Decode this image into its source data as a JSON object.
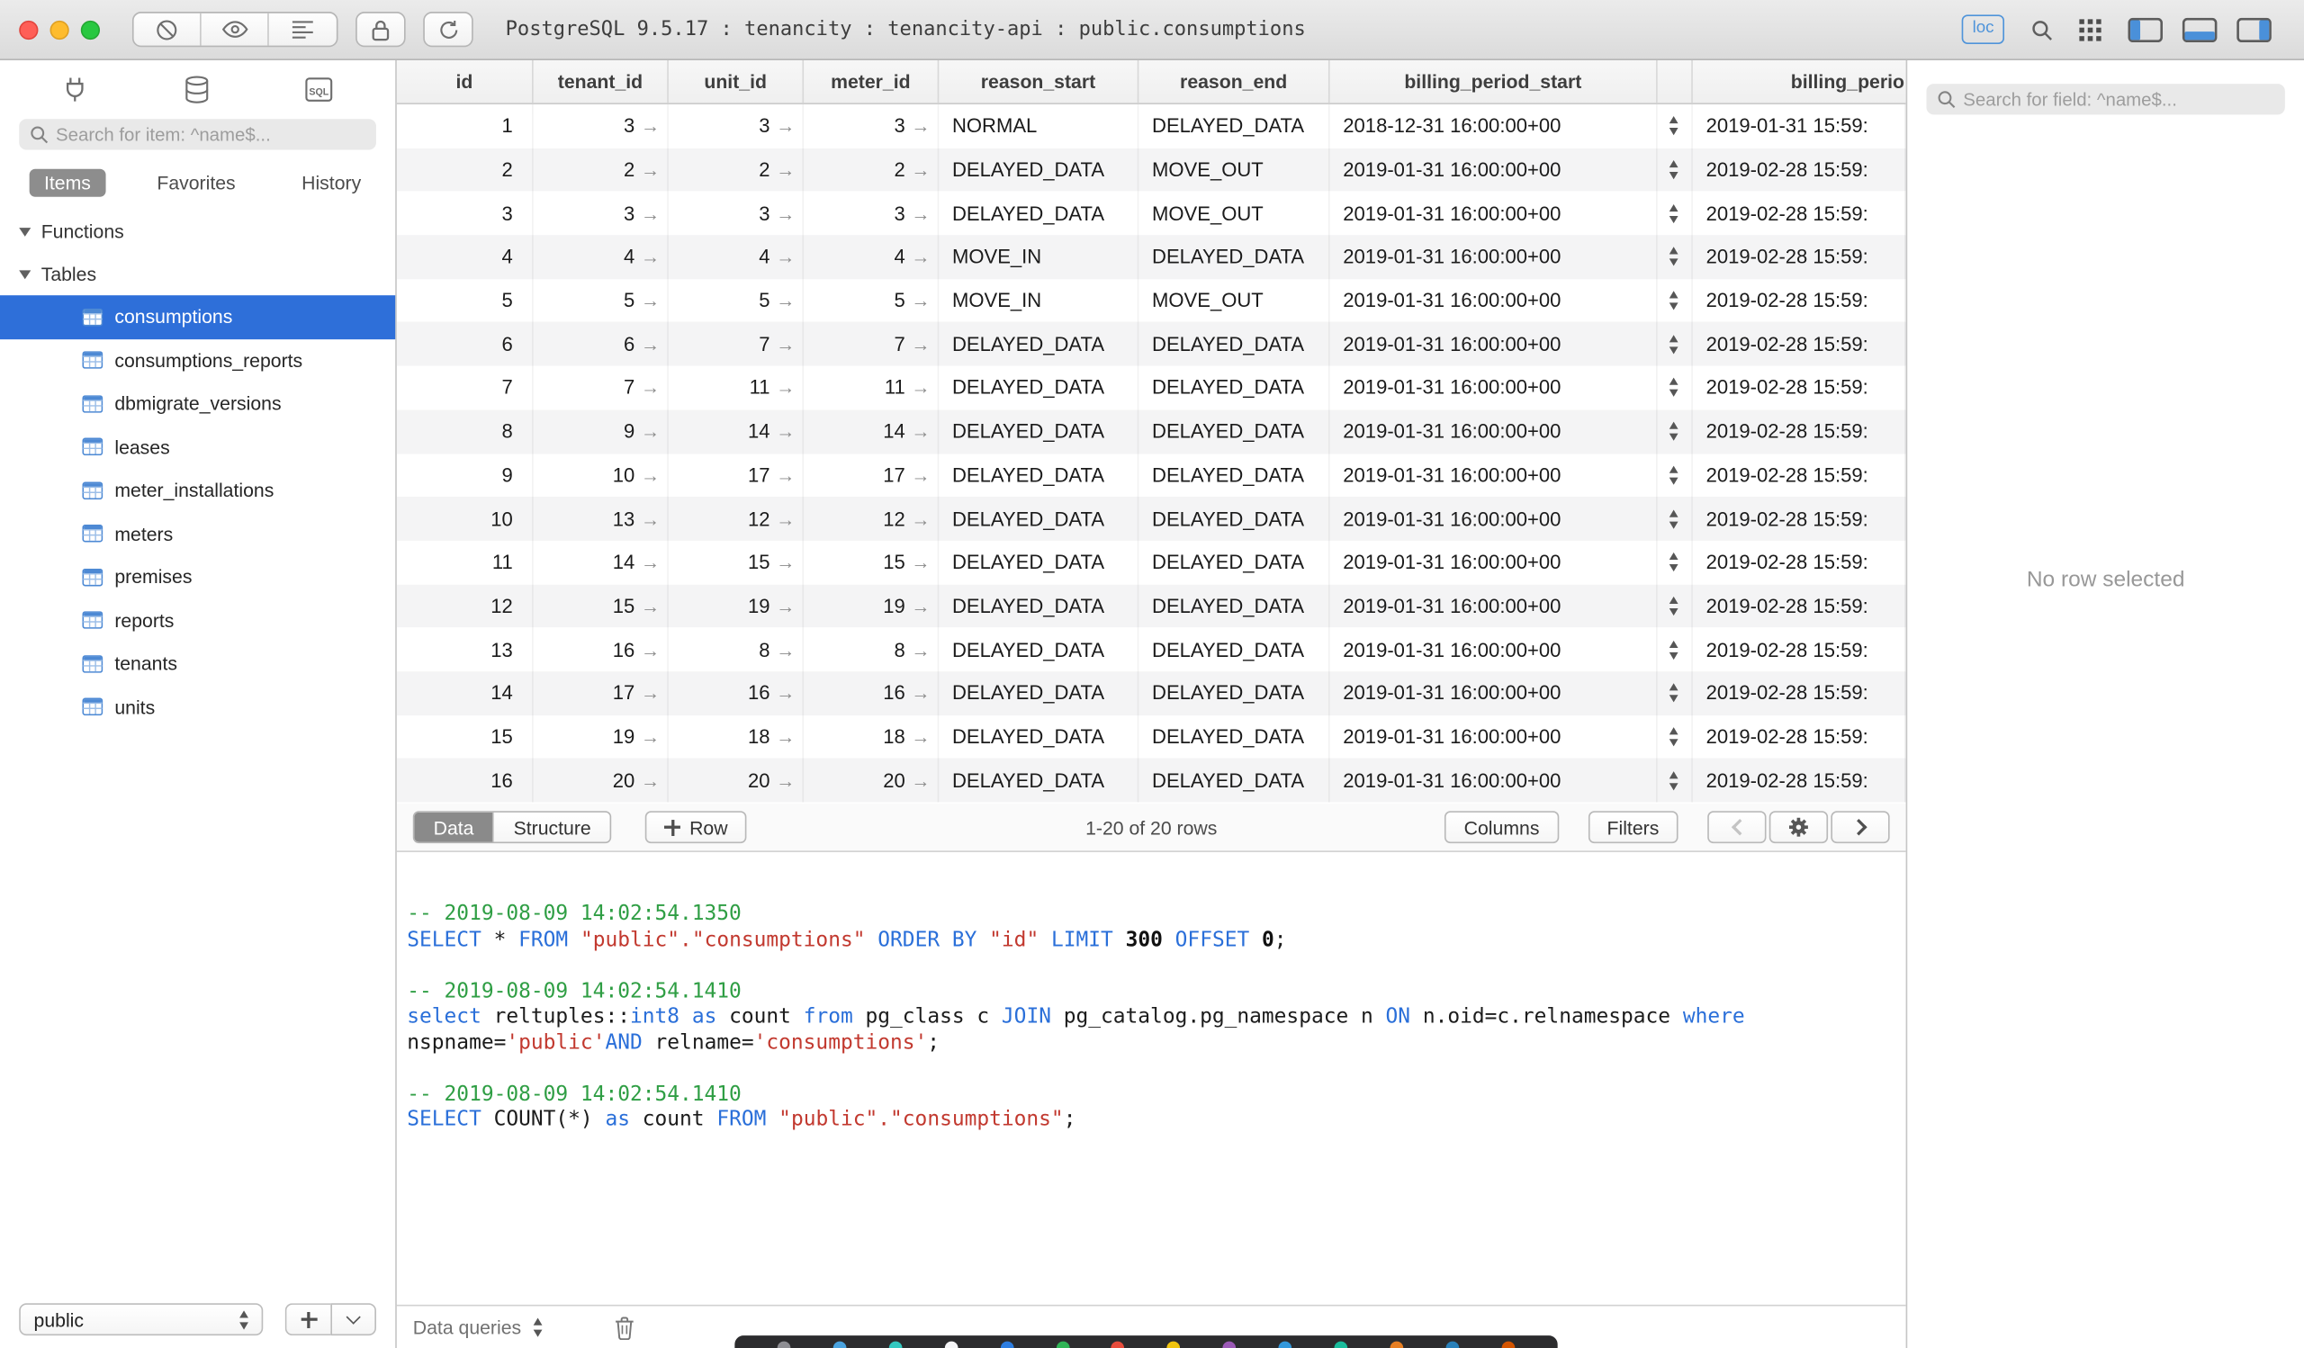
{
  "titlebar": {
    "title": "PostgreSQL 9.5.17 : tenancity : tenancity-api : public.consumptions",
    "loc_badge": "loc"
  },
  "sidebar": {
    "search_placeholder": "Search for item: ^name$...",
    "tabs": [
      "Items",
      "Favorites",
      "History"
    ],
    "selected_tab": "Items",
    "sections": [
      "Functions",
      "Tables"
    ],
    "tables": [
      "consumptions",
      "consumptions_reports",
      "dbmigrate_versions",
      "leases",
      "meter_installations",
      "meters",
      "premises",
      "reports",
      "tenants",
      "units"
    ],
    "selected_table": "consumptions",
    "schema": "public"
  },
  "grid": {
    "columns": [
      "id",
      "tenant_id",
      "unit_id",
      "meter_id",
      "reason_start",
      "reason_end",
      "billing_period_start",
      "",
      "billing_perio"
    ],
    "rows": [
      {
        "id": "1",
        "tenant_id": "3",
        "unit_id": "3",
        "meter_id": "3",
        "reason_start": "NORMAL",
        "reason_end": "DELAYED_DATA",
        "billing_period_start": "2018-12-31 16:00:00+00",
        "billing_period_end": "2019-01-31 15:59:"
      },
      {
        "id": "2",
        "tenant_id": "2",
        "unit_id": "2",
        "meter_id": "2",
        "reason_start": "DELAYED_DATA",
        "reason_end": "MOVE_OUT",
        "billing_period_start": "2019-01-31 16:00:00+00",
        "billing_period_end": "2019-02-28 15:59:"
      },
      {
        "id": "3",
        "tenant_id": "3",
        "unit_id": "3",
        "meter_id": "3",
        "reason_start": "DELAYED_DATA",
        "reason_end": "MOVE_OUT",
        "billing_period_start": "2019-01-31 16:00:00+00",
        "billing_period_end": "2019-02-28 15:59:"
      },
      {
        "id": "4",
        "tenant_id": "4",
        "unit_id": "4",
        "meter_id": "4",
        "reason_start": "MOVE_IN",
        "reason_end": "DELAYED_DATA",
        "billing_period_start": "2019-01-31 16:00:00+00",
        "billing_period_end": "2019-02-28 15:59:"
      },
      {
        "id": "5",
        "tenant_id": "5",
        "unit_id": "5",
        "meter_id": "5",
        "reason_start": "MOVE_IN",
        "reason_end": "MOVE_OUT",
        "billing_period_start": "2019-01-31 16:00:00+00",
        "billing_period_end": "2019-02-28 15:59:"
      },
      {
        "id": "6",
        "tenant_id": "6",
        "unit_id": "7",
        "meter_id": "7",
        "reason_start": "DELAYED_DATA",
        "reason_end": "DELAYED_DATA",
        "billing_period_start": "2019-01-31 16:00:00+00",
        "billing_period_end": "2019-02-28 15:59:"
      },
      {
        "id": "7",
        "tenant_id": "7",
        "unit_id": "11",
        "meter_id": "11",
        "reason_start": "DELAYED_DATA",
        "reason_end": "DELAYED_DATA",
        "billing_period_start": "2019-01-31 16:00:00+00",
        "billing_period_end": "2019-02-28 15:59:"
      },
      {
        "id": "8",
        "tenant_id": "9",
        "unit_id": "14",
        "meter_id": "14",
        "reason_start": "DELAYED_DATA",
        "reason_end": "DELAYED_DATA",
        "billing_period_start": "2019-01-31 16:00:00+00",
        "billing_period_end": "2019-02-28 15:59:"
      },
      {
        "id": "9",
        "tenant_id": "10",
        "unit_id": "17",
        "meter_id": "17",
        "reason_start": "DELAYED_DATA",
        "reason_end": "DELAYED_DATA",
        "billing_period_start": "2019-01-31 16:00:00+00",
        "billing_period_end": "2019-02-28 15:59:"
      },
      {
        "id": "10",
        "tenant_id": "13",
        "unit_id": "12",
        "meter_id": "12",
        "reason_start": "DELAYED_DATA",
        "reason_end": "DELAYED_DATA",
        "billing_period_start": "2019-01-31 16:00:00+00",
        "billing_period_end": "2019-02-28 15:59:"
      },
      {
        "id": "11",
        "tenant_id": "14",
        "unit_id": "15",
        "meter_id": "15",
        "reason_start": "DELAYED_DATA",
        "reason_end": "DELAYED_DATA",
        "billing_period_start": "2019-01-31 16:00:00+00",
        "billing_period_end": "2019-02-28 15:59:"
      },
      {
        "id": "12",
        "tenant_id": "15",
        "unit_id": "19",
        "meter_id": "19",
        "reason_start": "DELAYED_DATA",
        "reason_end": "DELAYED_DATA",
        "billing_period_start": "2019-01-31 16:00:00+00",
        "billing_period_end": "2019-02-28 15:59:"
      },
      {
        "id": "13",
        "tenant_id": "16",
        "unit_id": "8",
        "meter_id": "8",
        "reason_start": "DELAYED_DATA",
        "reason_end": "DELAYED_DATA",
        "billing_period_start": "2019-01-31 16:00:00+00",
        "billing_period_end": "2019-02-28 15:59:"
      },
      {
        "id": "14",
        "tenant_id": "17",
        "unit_id": "16",
        "meter_id": "16",
        "reason_start": "DELAYED_DATA",
        "reason_end": "DELAYED_DATA",
        "billing_period_start": "2019-01-31 16:00:00+00",
        "billing_period_end": "2019-02-28 15:59:"
      },
      {
        "id": "15",
        "tenant_id": "19",
        "unit_id": "18",
        "meter_id": "18",
        "reason_start": "DELAYED_DATA",
        "reason_end": "DELAYED_DATA",
        "billing_period_start": "2019-01-31 16:00:00+00",
        "billing_period_end": "2019-02-28 15:59:"
      },
      {
        "id": "16",
        "tenant_id": "20",
        "unit_id": "20",
        "meter_id": "20",
        "reason_start": "DELAYED_DATA",
        "reason_end": "DELAYED_DATA",
        "billing_period_start": "2019-01-31 16:00:00+00",
        "billing_period_end": "2019-02-28 15:59:"
      }
    ]
  },
  "grid_toolbar": {
    "view_tabs": [
      "Data",
      "Structure"
    ],
    "selected_view": "Data",
    "add_row_label": "Row",
    "row_count": "1-20 of 20 rows",
    "columns_label": "Columns",
    "filters_label": "Filters"
  },
  "sql_log": {
    "blocks": [
      {
        "comment": "-- 2019-08-09 14:02:54.1350",
        "lines": [
          [
            [
              "k",
              "SELECT"
            ],
            [
              "p",
              " * "
            ],
            [
              "k",
              "FROM"
            ],
            [
              "p",
              " "
            ],
            [
              "s",
              "\"public\".\"consumptions\""
            ],
            [
              "p",
              " "
            ],
            [
              "k",
              "ORDER BY"
            ],
            [
              "p",
              " "
            ],
            [
              "s",
              "\"id\""
            ],
            [
              "p",
              " "
            ],
            [
              "k",
              "LIMIT"
            ],
            [
              "p",
              " "
            ],
            [
              "n",
              "300"
            ],
            [
              "p",
              " "
            ],
            [
              "k",
              "OFFSET"
            ],
            [
              "p",
              " "
            ],
            [
              "n",
              "0"
            ],
            [
              "p",
              ";"
            ]
          ]
        ]
      },
      {
        "comment": "-- 2019-08-09 14:02:54.1410",
        "lines": [
          [
            [
              "k",
              "select"
            ],
            [
              "p",
              " reltuples::"
            ],
            [
              "k",
              "int8"
            ],
            [
              "p",
              " "
            ],
            [
              "k",
              "as"
            ],
            [
              "p",
              " count "
            ],
            [
              "k",
              "from"
            ],
            [
              "p",
              " pg_class c "
            ],
            [
              "k",
              "JOIN"
            ],
            [
              "p",
              " pg_catalog.pg_namespace n "
            ],
            [
              "k",
              "ON"
            ],
            [
              "p",
              " n.oid=c.relnamespace "
            ],
            [
              "k",
              "where"
            ]
          ],
          [
            [
              "p",
              "nspname="
            ],
            [
              "s",
              "'public'"
            ],
            [
              "k",
              "AND"
            ],
            [
              "p",
              " relname="
            ],
            [
              "s",
              "'consumptions'"
            ],
            [
              "p",
              ";"
            ]
          ]
        ]
      },
      {
        "comment": "-- 2019-08-09 14:02:54.1410",
        "lines": [
          [
            [
              "k",
              "SELECT"
            ],
            [
              "p",
              " COUNT(*) "
            ],
            [
              "k",
              "as"
            ],
            [
              "p",
              " count "
            ],
            [
              "k",
              "FROM"
            ],
            [
              "p",
              " "
            ],
            [
              "s",
              "\"public\".\"consumptions\""
            ],
            [
              "p",
              ";"
            ]
          ]
        ]
      }
    ]
  },
  "bottom_bar": {
    "label": "Data queries"
  },
  "right_panel": {
    "search_placeholder": "Search for field: ^name$...",
    "empty_message": "No row selected"
  },
  "dock": {
    "icon_colors": [
      "#8e8e93",
      "#4aa3df",
      "#34c8c0",
      "#f5f5f7",
      "#2d7de0",
      "#30b456",
      "#e74c3c",
      "#f1c40f",
      "#9b59b6",
      "#3498db",
      "#1abc9c",
      "#e67e22",
      "#2980b9",
      "#d35400"
    ]
  },
  "colors": {
    "accent_blue": "#2e6fd9",
    "selection_blue": "#2e6fd9"
  }
}
